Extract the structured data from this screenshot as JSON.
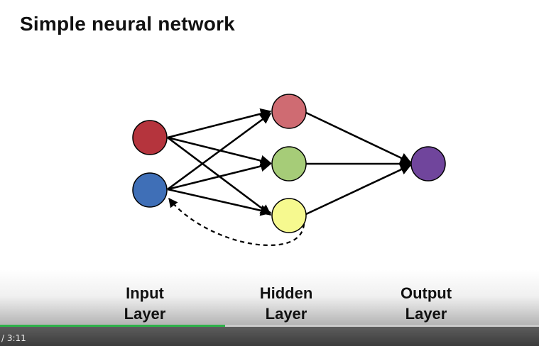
{
  "title": "Simple neural network",
  "layers": {
    "input": [
      "Input",
      "Layer"
    ],
    "hidden": [
      "Hidden",
      "Layer"
    ],
    "output": [
      "Output",
      "Layer"
    ]
  },
  "nodes": {
    "input": [
      "#b5343d",
      "#3f6fb7"
    ],
    "hidden": [
      "#cf6b72",
      "#a6cc78",
      "#f6f98f"
    ],
    "output": [
      "#70459c"
    ]
  },
  "player": {
    "time_text": "/  3:11",
    "progress": 0.417,
    "progress_color": "#2fb14a"
  }
}
